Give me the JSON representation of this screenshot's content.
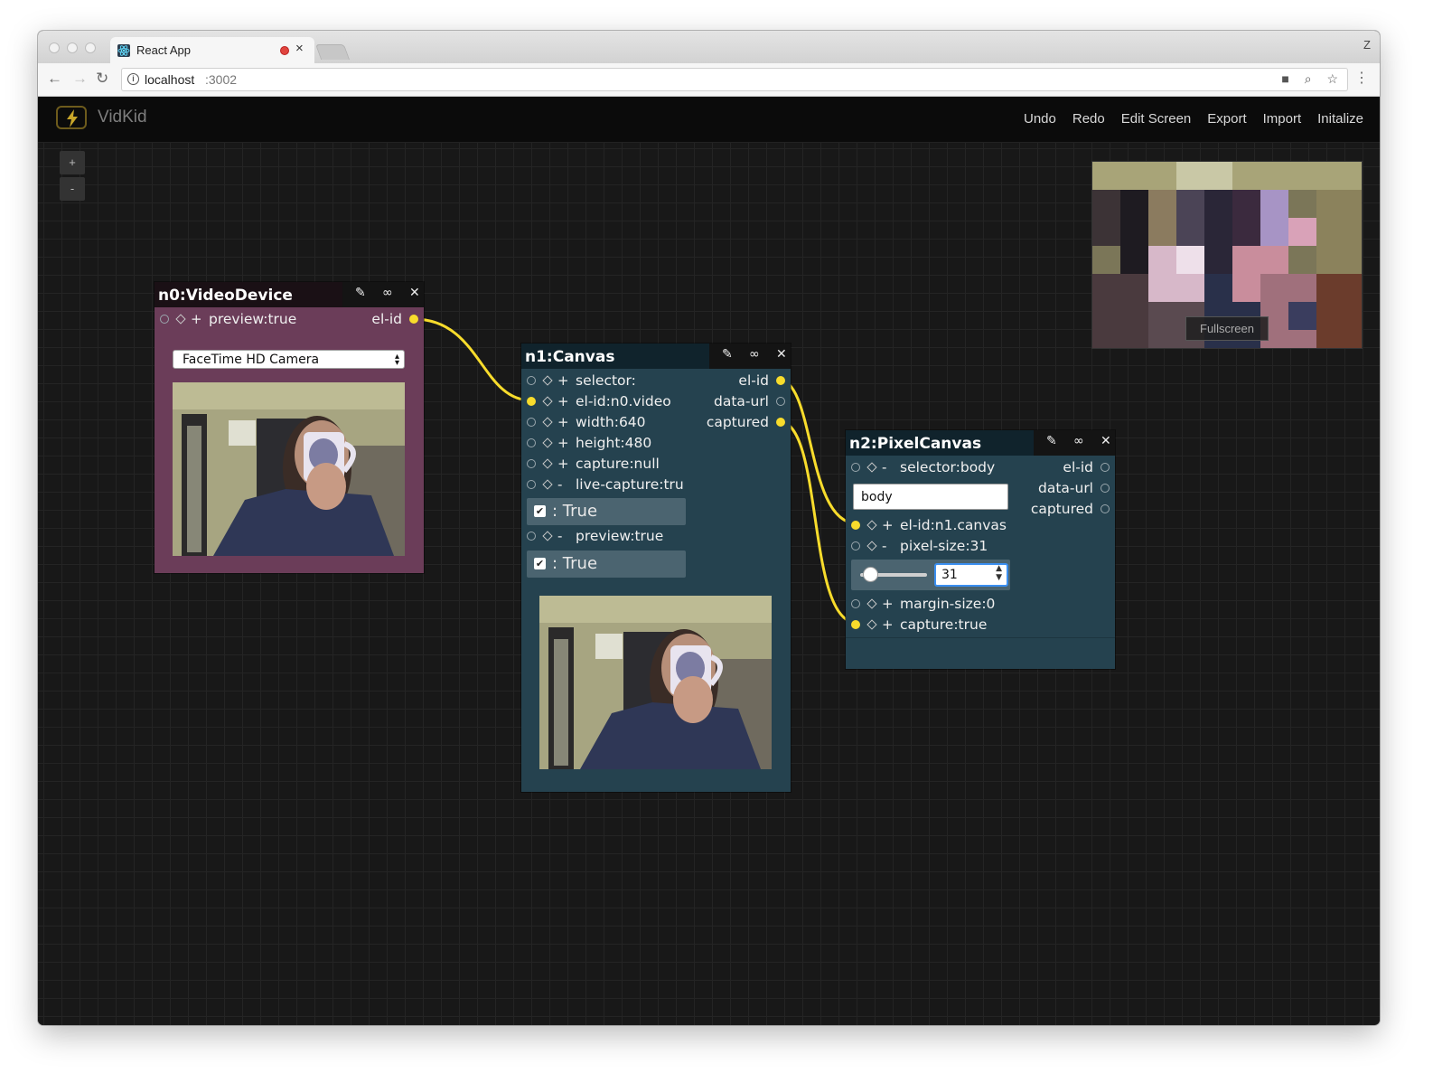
{
  "browser": {
    "tab_title": "React App",
    "tab_close": "×",
    "profile_initial": "Z",
    "url_host": "localhost",
    "url_port": ":3002",
    "back_icon": "←",
    "forward_icon": "→",
    "reload_icon": "↻",
    "camera_icon": "■",
    "zoom_icon": "⌕",
    "star_icon": "☆",
    "menu_icon": "⋮"
  },
  "app": {
    "name": "VidKid",
    "menu": [
      "Undo",
      "Redo",
      "Edit Screen",
      "Export",
      "Import",
      "Initalize"
    ]
  },
  "zoom": {
    "plus": "+",
    "minus": "-"
  },
  "preview": {
    "fullscreen_label": "Fullscreen"
  },
  "nodes": {
    "n0": {
      "title": "n0:VideoDevice",
      "inputs": [
        {
          "sign": "+",
          "label": "preview:true",
          "connected": false
        }
      ],
      "outputs": [
        {
          "label": "el-id",
          "connected": true
        }
      ],
      "camera_select": "FaceTime HD Camera"
    },
    "n1": {
      "title": "n1:Canvas",
      "inputs": [
        {
          "sign": "+",
          "label": "selector:",
          "connected": false
        },
        {
          "sign": "+",
          "label": "el-id:n0.video",
          "connected": true
        },
        {
          "sign": "+",
          "label": "width:640",
          "connected": false
        },
        {
          "sign": "+",
          "label": "height:480",
          "connected": false
        },
        {
          "sign": "+",
          "label": "capture:null",
          "connected": false
        },
        {
          "sign": "-",
          "label": "live-capture:tru",
          "connected": false
        },
        {
          "sign": "-",
          "label": "preview:true",
          "connected": false
        }
      ],
      "outputs": [
        {
          "label": "el-id",
          "connected": true
        },
        {
          "label": "data-url",
          "connected": false
        },
        {
          "label": "captured",
          "connected": true
        }
      ],
      "live_capture_check": ": True",
      "preview_check": ": True"
    },
    "n2": {
      "title": "n2:PixelCanvas",
      "inputs": [
        {
          "sign": "-",
          "label": "selector:body",
          "connected": false
        },
        {
          "sign": "+",
          "label": "el-id:n1.canvas",
          "connected": true
        },
        {
          "sign": "-",
          "label": "pixel-size:31",
          "connected": false
        },
        {
          "sign": "+",
          "label": "margin-size:0",
          "connected": false
        },
        {
          "sign": "+",
          "label": "capture:true",
          "connected": true
        }
      ],
      "outputs": [
        {
          "label": "el-id",
          "connected": false
        },
        {
          "label": "data-url",
          "connected": false
        },
        {
          "label": "captured",
          "connected": false
        }
      ],
      "selector_value": "body",
      "pixel_size_value": "31",
      "pixel_slider_fraction": 0.05
    }
  },
  "icons": {
    "edit": "pencil-icon",
    "link": "link-icon",
    "close": "close-icon"
  },
  "colors": {
    "wire": "#f8dc2c",
    "n0_body": "#6b3d59",
    "node_body": "#25424f"
  }
}
